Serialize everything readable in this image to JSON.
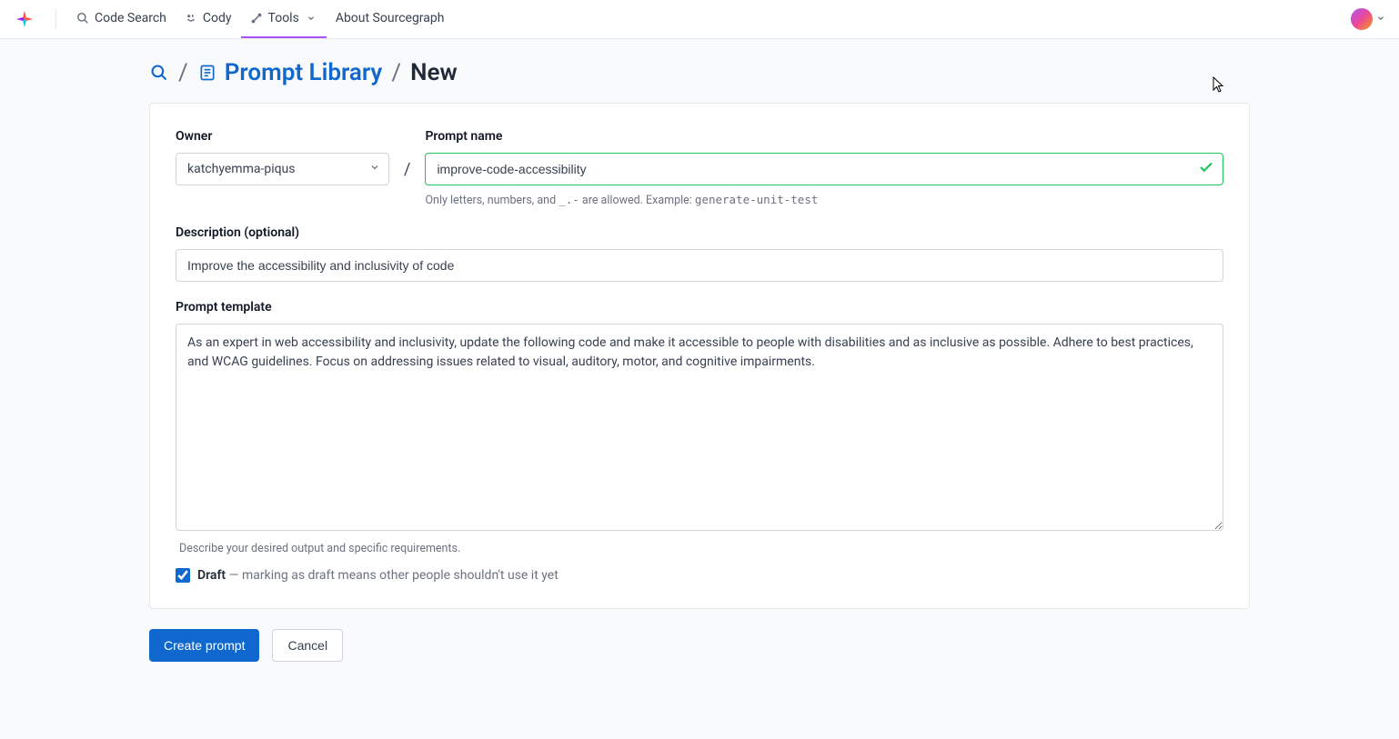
{
  "nav": {
    "code_search": "Code Search",
    "cody": "Cody",
    "tools": "Tools",
    "about": "About Sourcegraph"
  },
  "breadcrumb": {
    "library": "Prompt Library",
    "current": "New"
  },
  "form": {
    "owner_label": "Owner",
    "owner_value": "katchyemma-piqus",
    "name_label": "Prompt name",
    "name_value": "improve-code-accessibility",
    "name_hint_prefix": "Only letters, numbers, and ",
    "name_hint_chars": "_.-",
    "name_hint_middle": " are allowed. Example: ",
    "name_hint_example": "generate-unit-test",
    "desc_label": "Description (optional)",
    "desc_value": "Improve the accessibility and inclusivity of code",
    "template_label": "Prompt template",
    "template_value": "As an expert in web accessibility and inclusivity, update the following code and make it accessible to people with disabilities and as inclusive as possible. Adhere to best practices, and WCAG guidelines. Focus on addressing issues related to visual, auditory, motor, and cognitive impairments.",
    "template_hint": "Describe your desired output and specific requirements.",
    "draft_label": "Draft",
    "draft_hint": " — marking as draft means other people shouldn't use it yet",
    "draft_checked": true
  },
  "actions": {
    "create": "Create prompt",
    "cancel": "Cancel"
  }
}
